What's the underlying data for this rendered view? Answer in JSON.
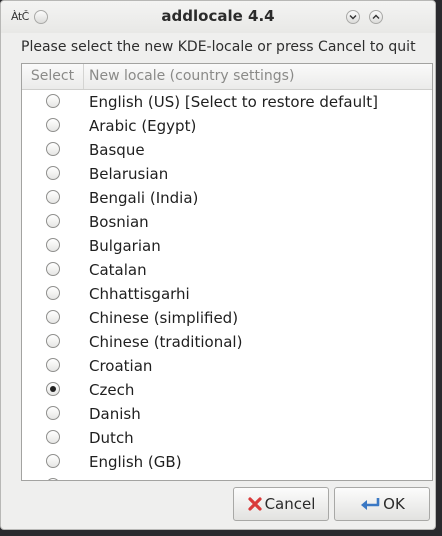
{
  "window": {
    "title": "addlocale 4.4",
    "app_icon_text": "ÀtČ"
  },
  "instruction": "Please select the new KDE-locale or press Cancel to quit",
  "list": {
    "columns": [
      "Select",
      "New locale (country settings)"
    ],
    "items": [
      {
        "label": "English (US) [Select to restore default]",
        "selected": false
      },
      {
        "label": "Arabic (Egypt)",
        "selected": false
      },
      {
        "label": "Basque",
        "selected": false
      },
      {
        "label": "Belarusian",
        "selected": false
      },
      {
        "label": "Bengali (India)",
        "selected": false
      },
      {
        "label": "Bosnian",
        "selected": false
      },
      {
        "label": "Bulgarian",
        "selected": false
      },
      {
        "label": "Catalan",
        "selected": false
      },
      {
        "label": "Chhattisgarhi",
        "selected": false
      },
      {
        "label": "Chinese (simplified)",
        "selected": false
      },
      {
        "label": "Chinese (traditional)",
        "selected": false
      },
      {
        "label": "Croatian",
        "selected": false
      },
      {
        "label": "Czech",
        "selected": true
      },
      {
        "label": "Danish",
        "selected": false
      },
      {
        "label": "Dutch",
        "selected": false
      },
      {
        "label": "English (GB)",
        "selected": false
      }
    ]
  },
  "buttons": {
    "cancel": {
      "label": "Cancel",
      "icon": "cancel-x-icon"
    },
    "ok": {
      "label": "OK",
      "icon": "enter-arrow-icon"
    }
  },
  "colors": {
    "cancel_icon": "#d93b3b",
    "ok_icon": "#3a78c4"
  }
}
